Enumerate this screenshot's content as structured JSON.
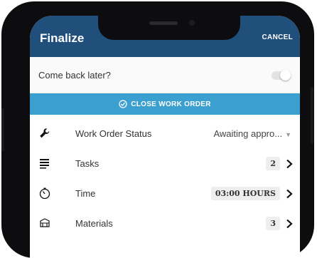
{
  "header": {
    "title": "Finalize",
    "cancel_label": "CANCEL"
  },
  "come_back_later": {
    "label": "Come back later?",
    "enabled": false
  },
  "close_button": {
    "label": "CLOSE WORK ORDER"
  },
  "rows": [
    {
      "label": "Work Order Status",
      "value": "Awaiting appro..."
    },
    {
      "label": "Tasks",
      "badge": "2"
    },
    {
      "label": "Time",
      "badge": "03:00 HOURS"
    },
    {
      "label": "Materials",
      "badge": "3"
    }
  ],
  "colors": {
    "header": "#1f4f7a",
    "accent": "#3b9fd0"
  }
}
